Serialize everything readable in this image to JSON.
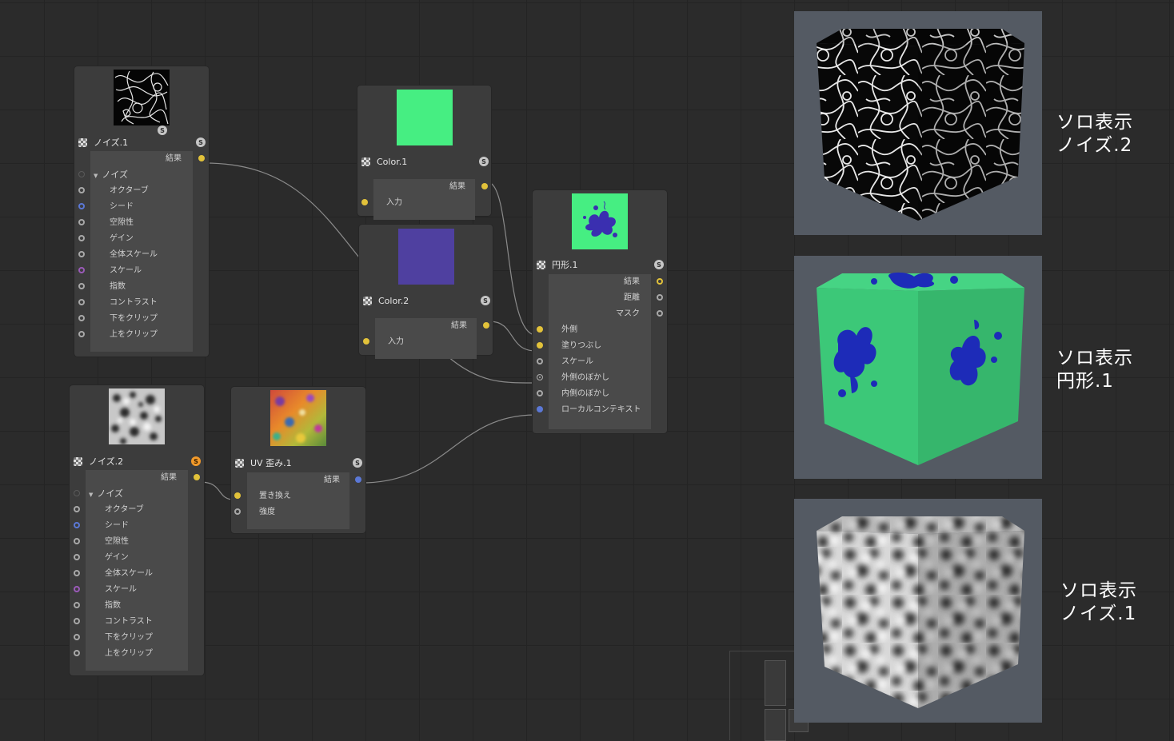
{
  "colors": {
    "accent_yellow": "#e2c23a",
    "port_blue": "#5b78d6",
    "port_purple": "#9a5ab8",
    "color1_swatch": "#46ee82",
    "color2_swatch": "#4f40a0",
    "solo_badge_orange": "#f29a2a"
  },
  "nodes": {
    "noise1": {
      "title": "ノイズ.1",
      "badge": "S",
      "thumb_badge": "S",
      "output": "結果",
      "group": "ノイズ",
      "params": [
        "オクターブ",
        "シード",
        "空隙性",
        "ゲイン",
        "全体スケール",
        "スケール",
        "指数",
        "コントラスト",
        "下をクリップ",
        "上をクリップ"
      ]
    },
    "noise2": {
      "title": "ノイズ.2",
      "badge": "S",
      "output": "結果",
      "group": "ノイズ",
      "params": [
        "オクターブ",
        "シード",
        "空隙性",
        "ゲイン",
        "全体スケール",
        "スケール",
        "指数",
        "コントラスト",
        "下をクリップ",
        "上をクリップ"
      ]
    },
    "color1": {
      "title": "Color.1",
      "badge": "S",
      "output": "結果",
      "input": "入力"
    },
    "color2": {
      "title": "Color.2",
      "badge": "S",
      "output": "結果",
      "input": "入力"
    },
    "circle1": {
      "title": "円形.1",
      "badge": "S",
      "outputs": [
        "結果",
        "距離",
        "マスク"
      ],
      "inputs": [
        "外側",
        "塗りつぶし",
        "スケール",
        "外側のぼかし",
        "内側のぼかし",
        "ローカルコンテキスト"
      ]
    },
    "uvdistort": {
      "title": "UV 歪み.1",
      "badge": "S",
      "output": "結果",
      "inputs": [
        "置き換え",
        "強度"
      ]
    }
  },
  "previews": [
    {
      "caption_line1": "ソロ表示",
      "caption_line2": "ノイズ.2",
      "icon": "cube-noise2-preview"
    },
    {
      "caption_line1": "ソロ表示",
      "caption_line2": "円形.1",
      "icon": "cube-circle-preview"
    },
    {
      "caption_line1": "ソロ表示",
      "caption_line2": "ノイズ.1",
      "icon": "cube-noise1-preview"
    }
  ]
}
